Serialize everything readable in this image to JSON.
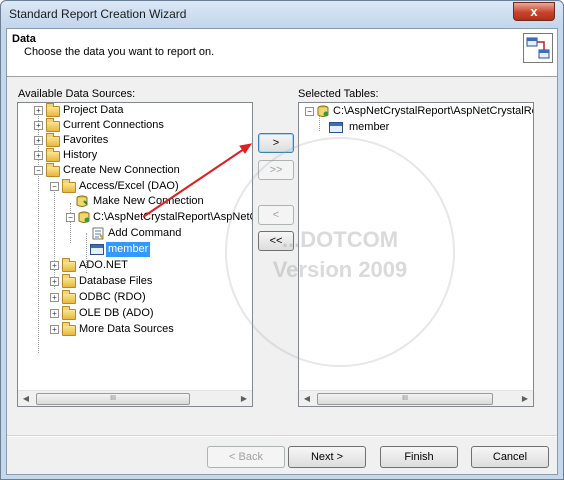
{
  "window": {
    "title": "Standard Report Creation Wizard",
    "close_glyph": "x"
  },
  "header": {
    "title": "Data",
    "subtitle": "Choose the data you want to report on.",
    "icon": "tables-link-icon"
  },
  "available": {
    "label": "Available Data Sources:",
    "items": [
      {
        "label": "Project Data",
        "expander": "+"
      },
      {
        "label": "Current Connections",
        "expander": "+"
      },
      {
        "label": "Favorites",
        "expander": "+"
      },
      {
        "label": "History",
        "expander": "+"
      },
      {
        "label": "Create New Connection",
        "expander": "−"
      },
      {
        "label": "Access/Excel (DAO)",
        "expander": "−"
      },
      {
        "label": "Make New Connection",
        "expander": ""
      },
      {
        "label": "C:\\AspNetCrystalReport\\AspNetCrys",
        "expander": "−"
      },
      {
        "label": "Add Command",
        "expander": ""
      },
      {
        "label": "member",
        "expander": ""
      },
      {
        "label": "ADO.NET",
        "expander": "+"
      },
      {
        "label": "Database Files",
        "expander": "+"
      },
      {
        "label": "ODBC (RDO)",
        "expander": "+"
      },
      {
        "label": "OLE DB (ADO)",
        "expander": "+"
      },
      {
        "label": "More Data Sources",
        "expander": "+"
      }
    ]
  },
  "selected": {
    "label": "Selected Tables:",
    "items": [
      {
        "label": "C:\\AspNetCrystalReport\\AspNetCrystalRep",
        "expander": "−"
      },
      {
        "label": "member",
        "expander": ""
      }
    ]
  },
  "move_buttons": {
    "add": ">",
    "add_all": ">>",
    "remove": "<",
    "remove_all": "<<"
  },
  "footer": {
    "back": "< Back",
    "next": "Next >",
    "finish": "Finish",
    "cancel": "Cancel"
  },
  "watermark": {
    "line1": "...DOTCOM",
    "line2": "Version 2009"
  },
  "colors": {
    "selection": "#3399ff",
    "arrow": "#e02020",
    "titlebar": "#c3d6ec"
  }
}
